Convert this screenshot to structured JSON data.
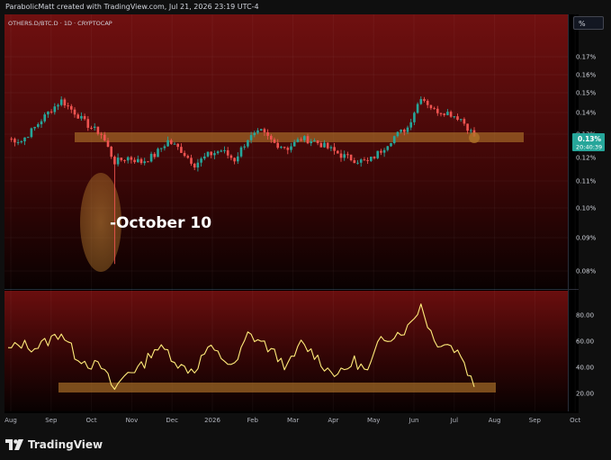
{
  "header": {
    "caption": "ParabolicMatt created with TradingView.com, Jul 21, 2026 23:19 UTC-4"
  },
  "symbol_label": "OTHERS.D/BTC.D · 1D · CRYPTOCAP",
  "scale_button": "%",
  "annotation": {
    "text": "-October 10"
  },
  "price_badge": {
    "value": "0.13%",
    "countdown": "20:40:39"
  },
  "brand": {
    "name": "TradingView"
  },
  "colors": {
    "up_candle": "#26a69a",
    "down_candle": "#ef5350",
    "oscillator": "#ffeb7a",
    "zone": "#b0742a",
    "bg_top": "#6e0b0b",
    "price_badge": "#26a69a"
  },
  "chart_data": [
    {
      "type": "candlestick",
      "title": "OTHERS.D/BTC.D · 1D · CRYPTOCAP",
      "y_axis": {
        "scale": "log",
        "ticks": [
          "0.17%",
          "0.16%",
          "0.15%",
          "0.14%",
          "0.13%",
          "0.12%",
          "0.11%",
          "0.10%",
          "0.09%",
          "0.08%"
        ]
      },
      "x_axis": {
        "ticks": [
          "Aug",
          "Sep",
          "Oct",
          "Nov",
          "Dec",
          "2026",
          "Feb",
          "Mar",
          "Apr",
          "May",
          "Jun",
          "Jul",
          "Aug",
          "Sep",
          "Oct"
        ]
      },
      "ylim": [
        0.0078,
        0.18
      ],
      "close_approx": [
        [
          "Aug",
          0.128
        ],
        [
          "Aug 10",
          0.127
        ],
        [
          "Aug 20",
          0.133
        ],
        [
          "Sep 1",
          0.14
        ],
        [
          "Sep 10",
          0.146
        ],
        [
          "Sep 20",
          0.14
        ],
        [
          "Oct 1",
          0.134
        ],
        [
          "Oct 9",
          0.13
        ],
        [
          "Oct 10",
          0.118
        ],
        [
          "Oct 20",
          0.12
        ],
        [
          "Nov 1",
          0.118
        ],
        [
          "Nov 10",
          0.121
        ],
        [
          "Nov 20",
          0.127
        ],
        [
          "Dec 1",
          0.123
        ],
        [
          "Dec 10",
          0.117
        ],
        [
          "Dec 20",
          0.121
        ],
        [
          "2026",
          0.123
        ],
        [
          "Jan 15",
          0.119
        ],
        [
          "Feb 1",
          0.128
        ],
        [
          "Feb 10",
          0.131
        ],
        [
          "Feb 20",
          0.126
        ],
        [
          "Mar 1",
          0.124
        ],
        [
          "Mar 10",
          0.128
        ],
        [
          "Mar 20",
          0.127
        ],
        [
          "Apr 1",
          0.124
        ],
        [
          "Apr 10",
          0.121
        ],
        [
          "Apr 20",
          0.119
        ],
        [
          "May 1",
          0.118
        ],
        [
          "May 10",
          0.123
        ],
        [
          "May 20",
          0.129
        ],
        [
          "Jun 1",
          0.133
        ],
        [
          "Jun 5",
          0.148
        ],
        [
          "Jun 15",
          0.141
        ],
        [
          "Jul 1",
          0.14
        ],
        [
          "Jul 10",
          0.137
        ],
        [
          "Jul 20",
          0.129
        ]
      ],
      "oct10_wick_low": 0.082,
      "resistance_zone": [
        0.127,
        0.131
      ],
      "last_price": "0.13%",
      "bar_countdown": "20:40:39"
    },
    {
      "type": "line",
      "y_axis": {
        "ticks": [
          "80.00",
          "60.00",
          "40.00",
          "20.00"
        ]
      },
      "ylim": [
        10,
        92
      ],
      "values_approx": [
        [
          "Aug",
          53
        ],
        [
          "Aug 10",
          58
        ],
        [
          "Aug 20",
          55
        ],
        [
          "Sep 1",
          60
        ],
        [
          "Sep 10",
          67
        ],
        [
          "Sep 20",
          50
        ],
        [
          "Oct 1",
          43
        ],
        [
          "Oct 9",
          40
        ],
        [
          "Oct 10",
          23
        ],
        [
          "Oct 20",
          37
        ],
        [
          "Nov 1",
          40
        ],
        [
          "Nov 10",
          55
        ],
        [
          "Nov 20",
          52
        ],
        [
          "Dec 1",
          40
        ],
        [
          "Dec 10",
          38
        ],
        [
          "Dec 20",
          55
        ],
        [
          "2026",
          48
        ],
        [
          "Jan 15",
          40
        ],
        [
          "Feb 1",
          65
        ],
        [
          "Feb 10",
          60
        ],
        [
          "Feb 20",
          50
        ],
        [
          "Mar 1",
          40
        ],
        [
          "Mar 10",
          58
        ],
        [
          "Mar 20",
          50
        ],
        [
          "Apr 1",
          38
        ],
        [
          "Apr 10",
          35
        ],
        [
          "Apr 20",
          45
        ],
        [
          "May 1",
          36
        ],
        [
          "May 10",
          62
        ],
        [
          "May 20",
          65
        ],
        [
          "Jun 1",
          70
        ],
        [
          "Jun 5",
          88
        ],
        [
          "Jun 15",
          60
        ],
        [
          "Jul 1",
          58
        ],
        [
          "Jul 10",
          50
        ],
        [
          "Jul 20",
          25
        ]
      ],
      "support_zone": [
        20,
        27
      ]
    }
  ]
}
